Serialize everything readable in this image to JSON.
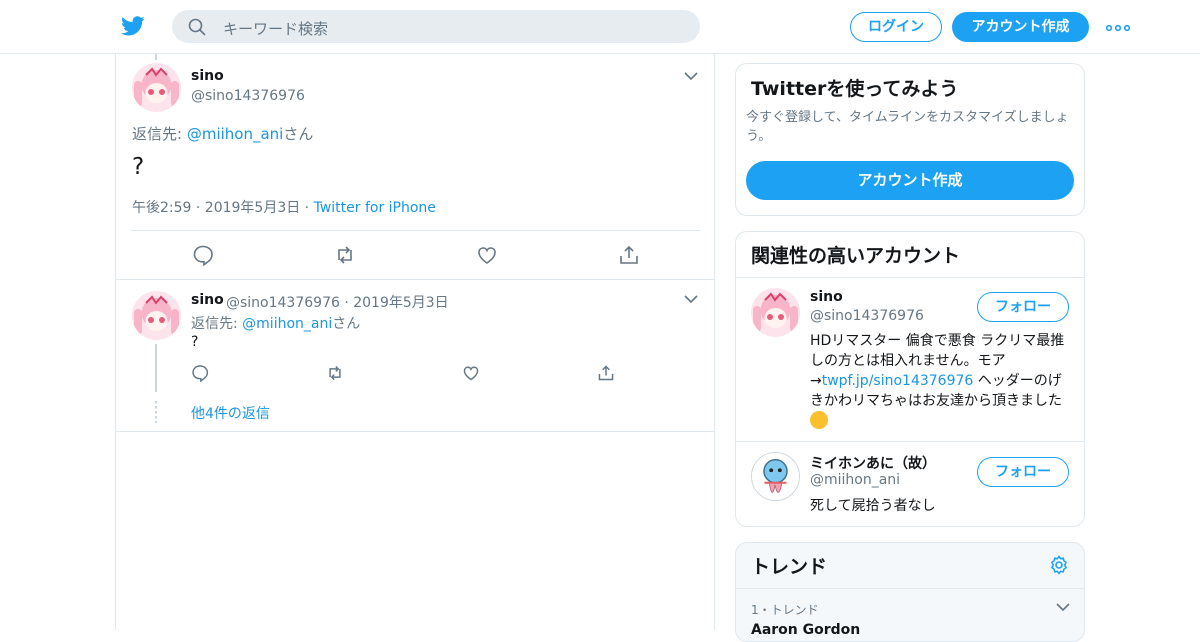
{
  "header": {
    "search_placeholder": "キーワード検索",
    "login_label": "ログイン",
    "signup_label": "アカウント作成"
  },
  "tweet_main": {
    "name": "sino",
    "handle": "@sino14376976",
    "reply_prefix": "返信先: ",
    "reply_to": "@miihon_ani",
    "reply_suffix": "さん",
    "text": "?",
    "time": "午後2:59 · 2019年5月3日",
    "sep": " · ",
    "source": "Twitter for iPhone"
  },
  "tweet_reply": {
    "name": "sino",
    "handle_date": "@sino14376976 · 2019年5月3日",
    "reply_prefix": "返信先: ",
    "reply_to": "@miihon_ani",
    "reply_suffix": "さん",
    "text": "?",
    "more_replies": "他4件の返信"
  },
  "signup_card": {
    "title": "Twitterを使ってみよう",
    "desc": "今すぐ登録して、タイムラインをカスタマイズしましょう。",
    "button": "アカウント作成"
  },
  "related": {
    "title": "関連性の高いアカウント",
    "follow_label": "フォロー",
    "accounts": [
      {
        "name": "sino",
        "handle": "@sino14376976",
        "bio_before": "HDリマスター 偏食で悪食 ラクリマ最推しの方とは相入れません。モア→",
        "bio_link": "twpf.jp/sino14376976",
        "bio_after": " ヘッダーのげきかわリマちゃはお友達から頂きました"
      },
      {
        "name": "ミイホンあに（故）",
        "handle": "@miihon_ani",
        "bio": "死して屍拾う者なし"
      }
    ]
  },
  "trends": {
    "title": "トレンド",
    "items": [
      {
        "label": "1・トレンド",
        "name": "Aaron Gordon"
      }
    ]
  },
  "colors": {
    "accent": "#1da1f2",
    "link": "#1b95e0",
    "muted": "#657786",
    "border": "#e1e8ed"
  }
}
